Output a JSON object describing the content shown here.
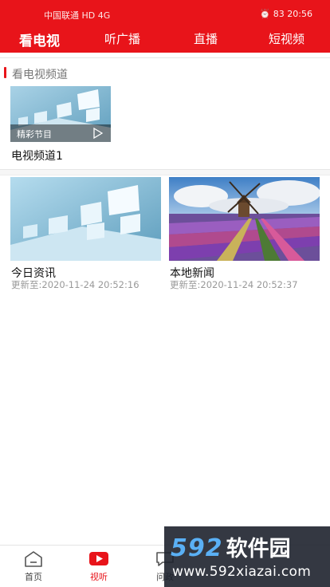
{
  "status_bar": {
    "carrier": "中国联通 HD 4G",
    "right": "⏰ 83 20:56"
  },
  "top_tabs": [
    {
      "label": "看电视",
      "active": true
    },
    {
      "label": "听广播",
      "active": false
    },
    {
      "label": "直播",
      "active": false
    },
    {
      "label": "短视频",
      "active": false
    }
  ],
  "section": {
    "title": "看电视频道",
    "channel": {
      "caption": "精彩节目",
      "name": "电视频道1",
      "icon": "play-icon"
    }
  },
  "news": [
    {
      "title": "今日资讯",
      "updated": "更新至:2020-11-24 20:52:16"
    },
    {
      "title": "本地新闻",
      "updated": "更新至:2020-11-24 20:52:37"
    }
  ],
  "bottom_nav": [
    {
      "label": "首页",
      "icon": "home-icon",
      "active": false
    },
    {
      "label": "视听",
      "icon": "video-play-icon",
      "active": true
    },
    {
      "label": "问政",
      "icon": "chat-icon",
      "active": false
    }
  ],
  "watermark": {
    "number": "592",
    "name": "软件园",
    "url": "www.592xiazai.com"
  },
  "colors": {
    "brand_red": "#e8141a",
    "watermark_blue": "#5ab0f5"
  }
}
